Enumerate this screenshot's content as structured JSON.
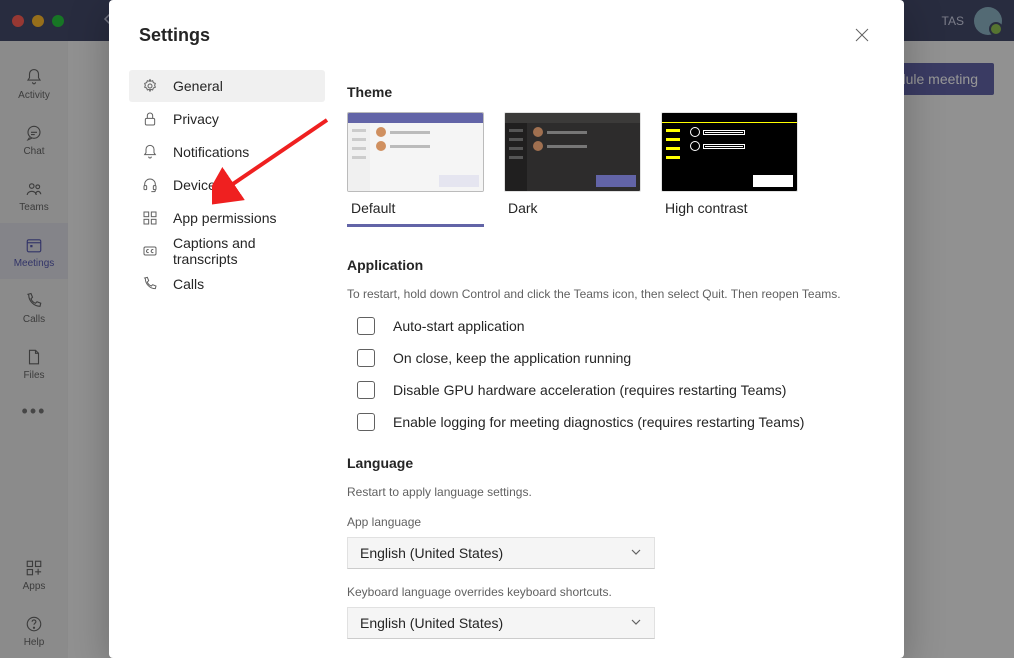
{
  "titlebar": {
    "user_initials": "TAS"
  },
  "rail": {
    "items": [
      {
        "label": "Activity"
      },
      {
        "label": "Chat"
      },
      {
        "label": "Teams"
      },
      {
        "label": "Meetings"
      },
      {
        "label": "Calls"
      },
      {
        "label": "Files"
      }
    ],
    "bottom": [
      {
        "label": "Apps"
      },
      {
        "label": "Help"
      }
    ]
  },
  "main": {
    "schedule_button": "dule meeting"
  },
  "settings": {
    "title": "Settings",
    "nav": [
      {
        "label": "General"
      },
      {
        "label": "Privacy"
      },
      {
        "label": "Notifications"
      },
      {
        "label": "Devices"
      },
      {
        "label": "App permissions"
      },
      {
        "label": "Captions and transcripts"
      },
      {
        "label": "Calls"
      }
    ],
    "theme": {
      "heading": "Theme",
      "options": [
        {
          "label": "Default"
        },
        {
          "label": "Dark"
        },
        {
          "label": "High contrast"
        }
      ]
    },
    "application": {
      "heading": "Application",
      "subtext": "To restart, hold down Control and click the Teams icon, then select Quit. Then reopen Teams.",
      "checkboxes": [
        {
          "label": "Auto-start application"
        },
        {
          "label": "On close, keep the application running"
        },
        {
          "label": "Disable GPU hardware acceleration (requires restarting Teams)"
        },
        {
          "label": "Enable logging for meeting diagnostics (requires restarting Teams)"
        }
      ]
    },
    "language": {
      "heading": "Language",
      "subtext": "Restart to apply language settings.",
      "app_language_label": "App language",
      "app_language_value": "English (United States)",
      "keyboard_label": "Keyboard language overrides keyboard shortcuts.",
      "keyboard_value": "English (United States)"
    }
  }
}
